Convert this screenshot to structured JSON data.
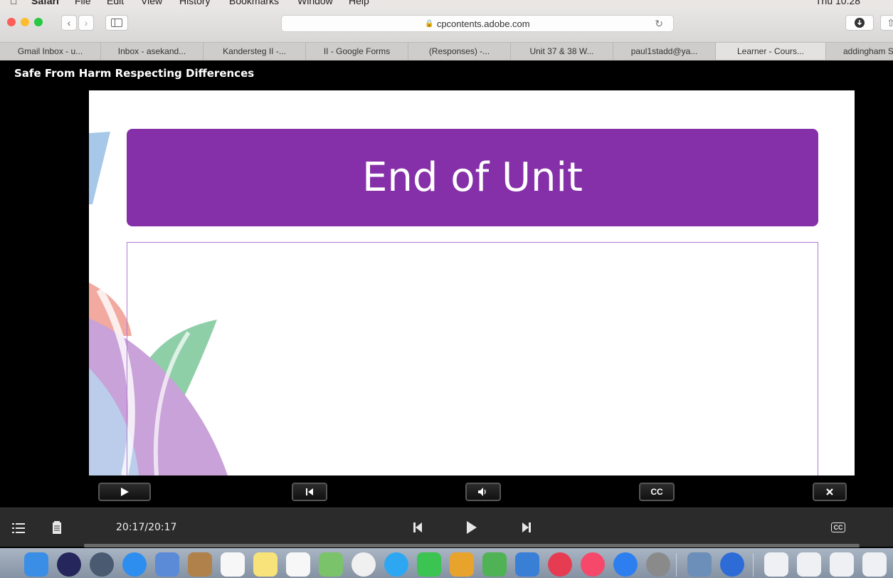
{
  "browser": {
    "menu_items": [
      "Safari",
      "File",
      "Edit",
      "View",
      "History",
      "Bookmarks",
      "Window",
      "Help"
    ],
    "clock": "Thu 10:28",
    "url": "cpcontents.adobe.com",
    "tabs": [
      {
        "label": "Gmail Inbox - u...",
        "active": false
      },
      {
        "label": "Inbox - asekand...",
        "active": false
      },
      {
        "label": "Kandersteg II -...",
        "active": false
      },
      {
        "label": "II - Google Forms",
        "active": false
      },
      {
        "label": "(Responses) -...",
        "active": false
      },
      {
        "label": "Unit 37 & 38 W...",
        "active": false
      },
      {
        "label": "paul1stadd@ya...",
        "active": false
      },
      {
        "label": "Learner - Cours...",
        "active": true
      },
      {
        "label": "addingham S",
        "active": false
      }
    ]
  },
  "course": {
    "title": "Safe From Harm Respecting Differences"
  },
  "slide": {
    "heading": "End of Unit",
    "banner_color": "#8530a9",
    "frame_color": "#b379d2"
  },
  "slide_playbar": {
    "buttons": [
      {
        "name": "play",
        "icon": "play-icon"
      },
      {
        "name": "rewind",
        "icon": "skip-to-start-icon"
      },
      {
        "name": "audio",
        "icon": "speaker-icon"
      },
      {
        "name": "captions",
        "label": "CC"
      },
      {
        "name": "close",
        "icon": "close-icon"
      }
    ]
  },
  "controls": {
    "time": "20:17/20:17",
    "cc_label": "CC",
    "progress": 1.0
  }
}
